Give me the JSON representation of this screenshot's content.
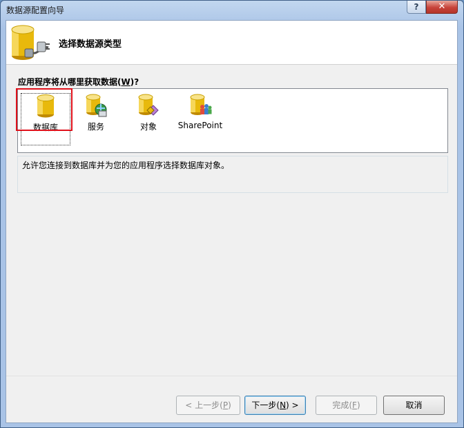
{
  "window": {
    "title": "数据源配置向导",
    "help_label": "?",
    "close_label": "✕"
  },
  "header": {
    "title": "选择数据源类型",
    "icon": "database-plug-icon"
  },
  "question": {
    "prefix": "应用程序将从哪里获取数据(",
    "accel": "W",
    "suffix": ")?"
  },
  "data_source_types": [
    {
      "label": "数据库",
      "icon": "database-icon",
      "selected": true
    },
    {
      "label": "服务",
      "icon": "service-icon",
      "selected": false
    },
    {
      "label": "对象",
      "icon": "object-icon",
      "selected": false
    },
    {
      "label": "SharePoint",
      "icon": "sharepoint-icon",
      "selected": false
    }
  ],
  "description": "允许您连接到数据库并为您的应用程序选择数据库对象。",
  "buttons": {
    "previous": {
      "prefix": "< 上一步(",
      "accel": "P",
      "suffix": ")",
      "enabled": false
    },
    "next": {
      "prefix": "下一步(",
      "accel": "N",
      "suffix": ") >",
      "enabled": true
    },
    "finish": {
      "prefix": "完成(",
      "accel": "F",
      "suffix": ")",
      "enabled": false
    },
    "cancel": {
      "label": "取消",
      "enabled": true
    }
  },
  "colors": {
    "selection_highlight": "#e0101a",
    "cylinder_gold": "#e8b90c"
  }
}
